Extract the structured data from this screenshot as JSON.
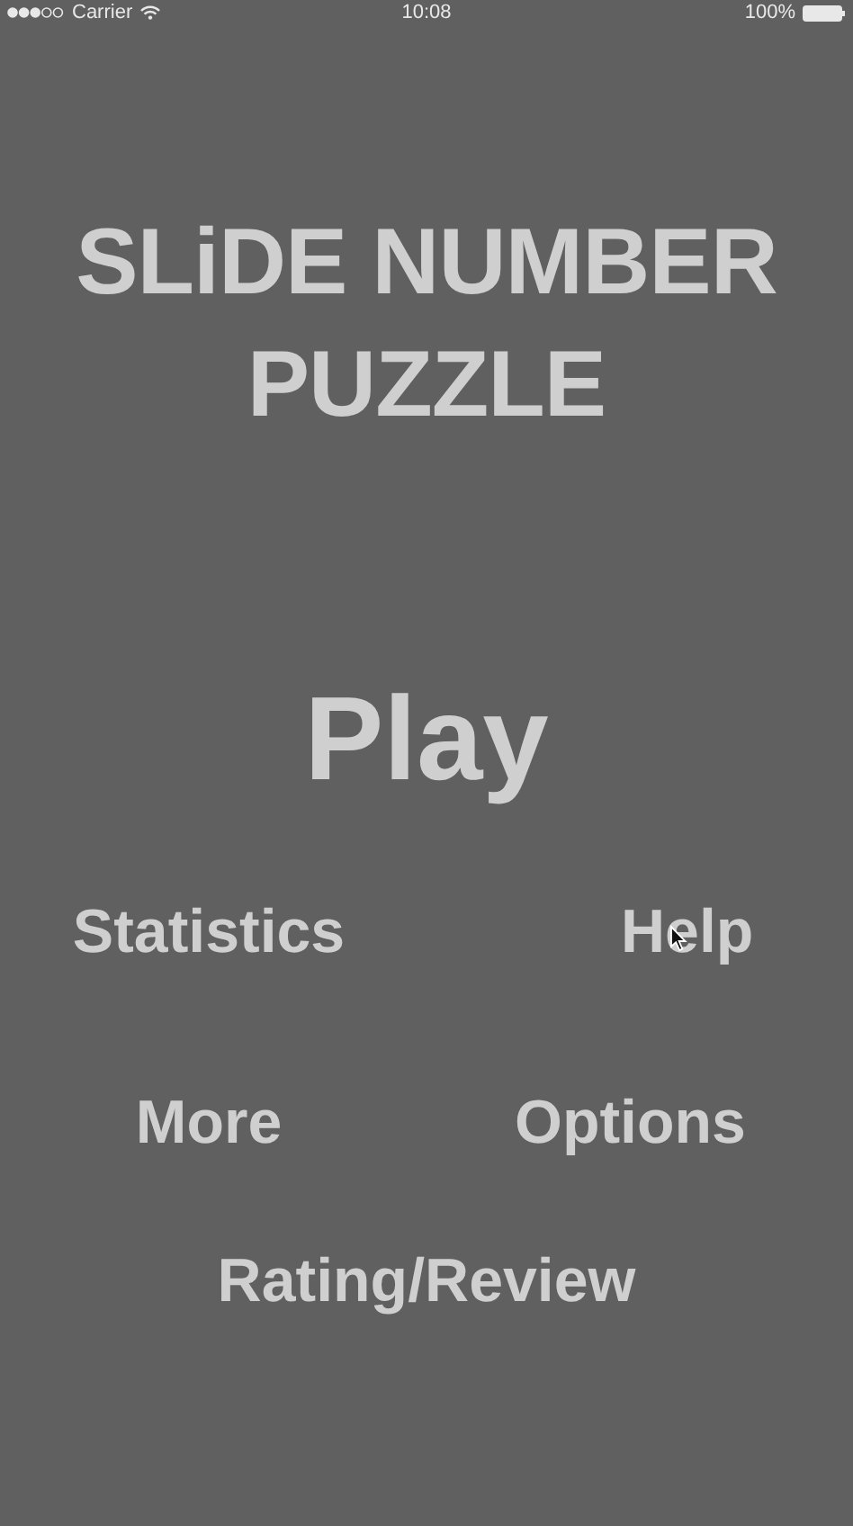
{
  "status_bar": {
    "carrier": "Carrier",
    "time": "10:08",
    "battery": "100%"
  },
  "title_lines": [
    "SLiDE NUMBER",
    "PUZZLE"
  ],
  "play": "Play",
  "menu_rows": [
    [
      "Statistics",
      "Help"
    ],
    [
      "More",
      "Options"
    ]
  ],
  "last_button": "Rating/Review"
}
